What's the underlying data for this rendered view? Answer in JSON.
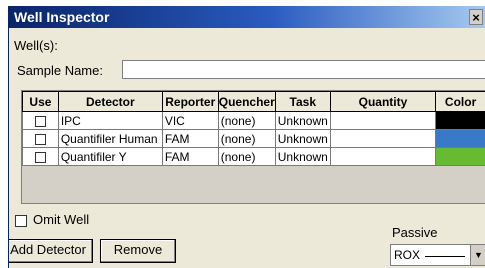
{
  "window": {
    "title": "Well Inspector",
    "close_glyph": "×"
  },
  "wells": {
    "label": "Well(s):"
  },
  "sample": {
    "label": "Sample Name:",
    "value": ""
  },
  "table": {
    "columns": [
      "Use",
      "Detector",
      "Reporter",
      "Quencher",
      "Task",
      "Quantity",
      "Color"
    ],
    "rows": [
      {
        "use": false,
        "detector": "IPC",
        "reporter": "VIC",
        "quencher": "(none)",
        "task": "Unknown",
        "quantity": "",
        "color": "#000000"
      },
      {
        "use": false,
        "detector": "Quantifiler Human",
        "reporter": "FAM",
        "quencher": "(none)",
        "task": "Unknown",
        "quantity": "",
        "color": "#3a78c8"
      },
      {
        "use": false,
        "detector": "Quantifiler Y",
        "reporter": "FAM",
        "quencher": "(none)",
        "task": "Unknown",
        "quantity": "",
        "color": "#66bb33"
      }
    ]
  },
  "omit_well": {
    "label": "Omit Well",
    "checked": false
  },
  "buttons": {
    "add_detector": "Add Detector",
    "remove": "Remove"
  },
  "passive": {
    "label": "Passive",
    "selected": "ROX",
    "arrow_glyph": "▼"
  }
}
